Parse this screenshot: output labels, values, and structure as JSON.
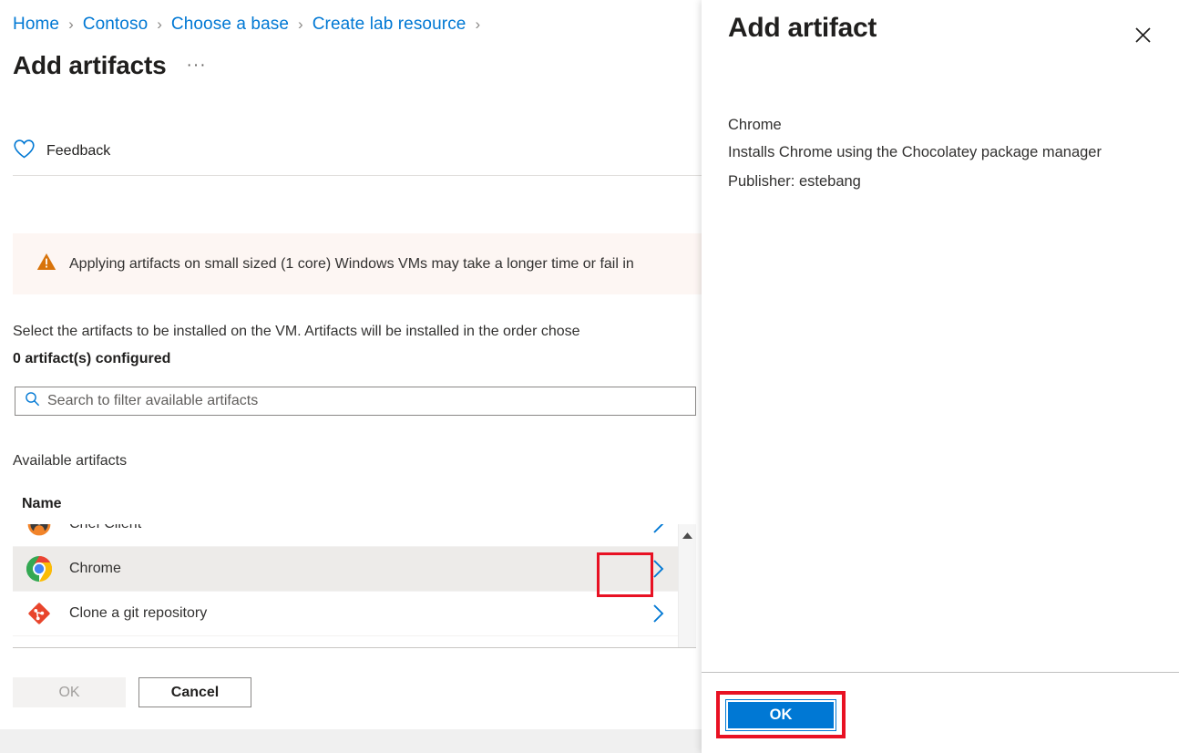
{
  "breadcrumb": {
    "items": [
      {
        "label": "Home"
      },
      {
        "label": "Contoso"
      },
      {
        "label": "Choose a base"
      },
      {
        "label": "Create lab resource"
      }
    ],
    "separator": "›"
  },
  "page": {
    "title": "Add artifacts",
    "ellipsis": "···"
  },
  "commandbar": {
    "feedback_label": "Feedback",
    "feedback_icon": "heart-icon"
  },
  "warning": {
    "icon": "warning-triangle-icon",
    "text": "Applying artifacts on small sized (1 core) Windows VMs may take a longer time or fail in",
    "background": "#fdf6f3",
    "icon_color": "#d8730a"
  },
  "description": {
    "line1": "Select the artifacts to be installed on the VM. Artifacts will be installed in the order chose",
    "configured": "0 artifact(s) configured"
  },
  "search": {
    "placeholder": "Search to filter available artifacts",
    "value": "",
    "icon": "search-icon"
  },
  "available": {
    "section_label": "Available artifacts",
    "column_header": "Name",
    "rows": [
      {
        "name": "Chef Client",
        "icon": "chef-icon",
        "chevron": "chevron-right-icon",
        "selected": false
      },
      {
        "name": "Chrome",
        "icon": "chrome-icon",
        "chevron": "chevron-right-icon",
        "selected": true
      },
      {
        "name": "Clone a git repository",
        "icon": "git-icon",
        "chevron": "chevron-right-icon",
        "selected": false
      },
      {
        "name": "",
        "icon": "partial-icon",
        "chevron": "",
        "selected": false
      }
    ],
    "scroll_up_icon": "scroll-up-arrow-icon"
  },
  "blade_footer": {
    "ok_label": "OK",
    "cancel_label": "Cancel"
  },
  "panel": {
    "title": "Add artifact",
    "close_icon": "close-icon",
    "artifact_name": "Chrome",
    "artifact_description": "Installs Chrome using the Chocolatey package manager",
    "artifact_publisher": "Publisher: estebang",
    "ok_label": "OK"
  },
  "colors": {
    "accent": "#0078d4",
    "link": "#0078d4",
    "annotation_highlight": "#e81123",
    "row_selected": "#edebe9",
    "warning_bg": "#fdf6f3"
  }
}
